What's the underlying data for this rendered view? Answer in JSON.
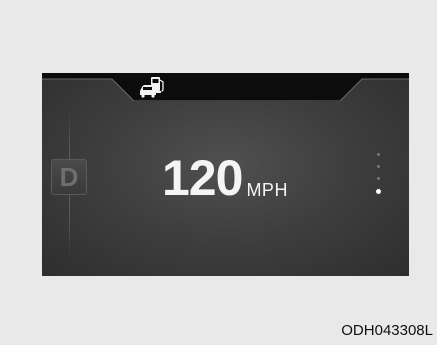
{
  "display": {
    "gear": "D",
    "speed": {
      "value": "120",
      "unit": "MPH"
    },
    "top_icon": "fuel-station-car-icon",
    "page_indicator": {
      "total": 4,
      "active_index": 4
    }
  },
  "caption": "ODH043308L",
  "colors": {
    "background": "#e9e9e9",
    "panel": "#3f3f3f",
    "text": "#f4f4f4",
    "gear": "#6e6e6e"
  }
}
